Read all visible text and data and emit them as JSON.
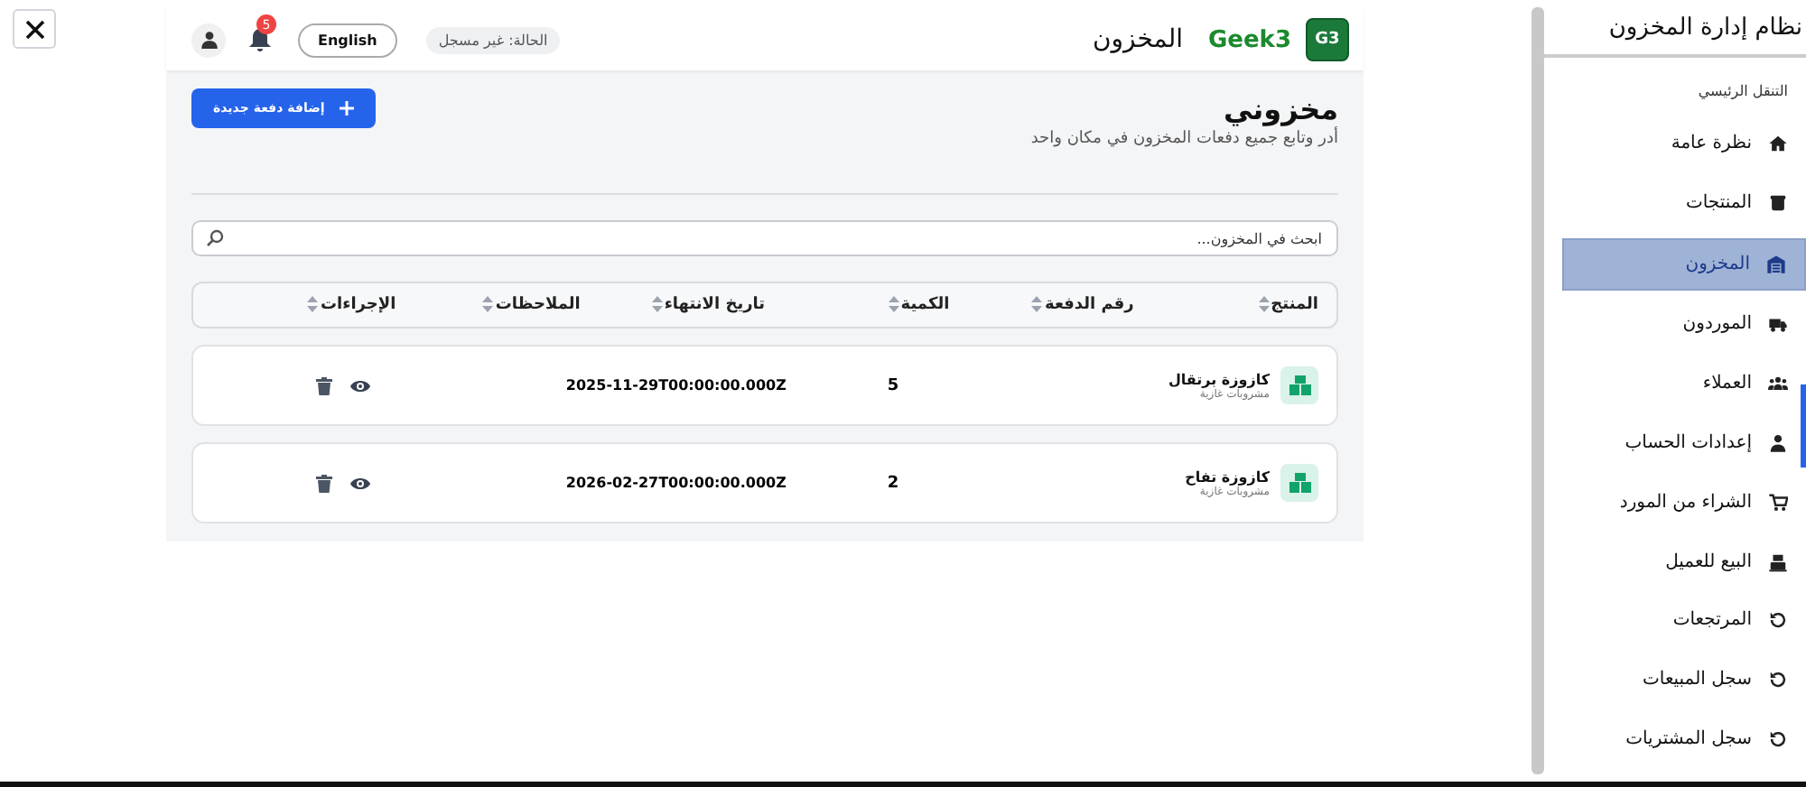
{
  "header": {
    "logo": "G3",
    "brand": "Geek3",
    "title": "المخزون",
    "status": "الحالة: غير مسجل",
    "language_button": "English",
    "notification_count": "5"
  },
  "page": {
    "title": "مخزوني",
    "subtitle": "أدر وتابع جميع دفعات المخزون في مكان واحد",
    "add_button": "إضافة دفعة جديدة"
  },
  "search": {
    "placeholder": "ابحث في المخزون..."
  },
  "table": {
    "columns": [
      "المنتج",
      "رقم الدفعة",
      "الكمية",
      "تاريخ الانتهاء",
      "الملاحظات",
      "الإجراءات"
    ],
    "rows": [
      {
        "product": "كازوزة برتقال",
        "category": "مشروبات غازية",
        "quantity": "5",
        "expiry": "2025-11-29T00:00:00.000Z"
      },
      {
        "product": "كازوزة تفاح",
        "category": "مشروبات غازية",
        "quantity": "2",
        "expiry": "2026-02-27T00:00:00.000Z"
      }
    ]
  },
  "sidebar": {
    "title": "نظام إدارة المخزون",
    "section": "التنقل الرئيسي",
    "items": [
      {
        "label": "نظرة عامة",
        "selected": false
      },
      {
        "label": "المنتجات",
        "selected": false
      },
      {
        "label": "المخزون",
        "selected": true
      },
      {
        "label": "الموردون",
        "selected": false
      },
      {
        "label": "العملاء",
        "selected": false
      },
      {
        "label": "إعدادات الحساب",
        "selected": false
      },
      {
        "label": "الشراء من المورد",
        "selected": false
      },
      {
        "label": "البيع للعميل",
        "selected": false
      },
      {
        "label": "المرتجعات",
        "selected": false
      },
      {
        "label": "سجل المبيعات",
        "selected": false
      },
      {
        "label": "سجل المشتريات",
        "selected": false
      }
    ]
  }
}
